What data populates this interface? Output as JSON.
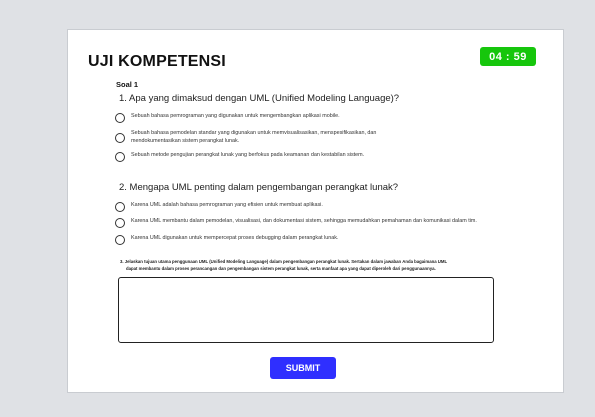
{
  "header": {
    "title": "UJI KOMPETENSI",
    "timer": "04 : 59"
  },
  "section_label": "Soal 1",
  "questions": [
    {
      "text": "1. Apa yang dimaksud dengan UML (Unified Modeling Language)?",
      "options": [
        "Sebuah bahasa pemrograman yang digunakan untuk mengembangkan aplikasi mobile.",
        "Sebuah bahasa pemodelan standar yang digunakan untuk memvisualisasikan, menspesifikasikan, dan",
        "Sebuah metode pengujian perangkat lunak yang berfokus pada keamanan dan kestabilan sistem."
      ],
      "option_1_line2": "mendokumentasikan sistem perangkat lunak."
    },
    {
      "text": "2. Mengapa UML penting dalam pengembangan perangkat lunak?",
      "options": [
        "Karena UML adalah bahasa pemrograman yang efisien untuk membuat aplikasi.",
        "Karena UML membantu dalam pemodelan, visualisasi, dan dokumentasi sistem, sehingga memudahkan pemahaman dan komunikasi dalam tim.",
        "Karena UML digunakan untuk mempercepat proses debugging dalam perangkat lunak."
      ]
    },
    {
      "text_line1": "3. Jelaskan tujuan utama penggunaan UML (Unified Modeling Language) dalam pengembangan perangkat lunak. Sertakan dalam jawaban Anda bagaimana UML",
      "text_line2": "dapat membantu dalam proses perancangan dan pengembangan sistem perangkat lunak, serta manfaat apa yang dapat diperoleh dari penggunaannya.",
      "answer_value": ""
    }
  ],
  "submit_label": "SUBMIT"
}
